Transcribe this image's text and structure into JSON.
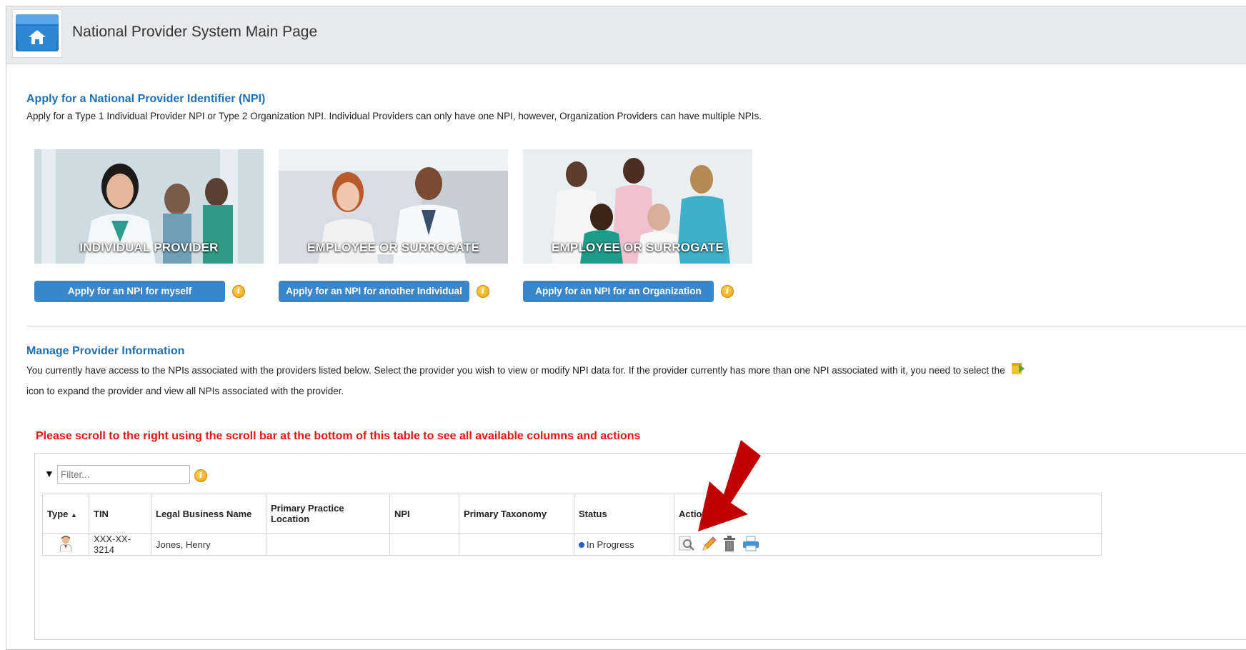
{
  "header": {
    "title": "National Provider System Main Page"
  },
  "apply": {
    "heading": "Apply for a National Provider Identifier (NPI)",
    "description": "Apply for a Type 1 Individual Provider NPI or Type 2 Organization NPI. Individual Providers can only have one NPI, however, Organization Providers can have multiple NPIs."
  },
  "tiles": [
    {
      "caption": "INDIVIDUAL PROVIDER",
      "button": "Apply for an NPI for myself"
    },
    {
      "caption": "EMPLOYEE OR SURROGATE",
      "button": "Apply for an NPI for another Individual"
    },
    {
      "caption": "EMPLOYEE OR SURROGATE",
      "button": "Apply for an NPI for an Organization"
    }
  ],
  "manage": {
    "heading": "Manage Provider Information",
    "line1": "You currently have access to the NPIs associated with the providers listed below. Select the provider you wish to view or modify NPI data for. If the provider currently has more than one NPI associated with it, you need to select the",
    "line2": "icon to expand the provider and view all NPIs associated with the provider."
  },
  "scroll_note": "Please scroll to the right using the scroll bar at the bottom of this table to see all available columns and actions",
  "filter": {
    "placeholder": "Filter..."
  },
  "table": {
    "columns": [
      "Type",
      "TIN",
      "Legal Business Name",
      "Primary Practice Location",
      "NPI",
      "Primary Taxonomy",
      "Status",
      "Action"
    ],
    "rows": [
      {
        "tin": "XXX-XX-3214",
        "name": "Jones, Henry",
        "location": "",
        "npi": "",
        "taxonomy": "",
        "status": "In Progress"
      }
    ]
  },
  "colors": {
    "accent": "#1f6fb4",
    "button": "#3a86c8",
    "warning": "#e8140f",
    "arrow": "#c00000"
  }
}
